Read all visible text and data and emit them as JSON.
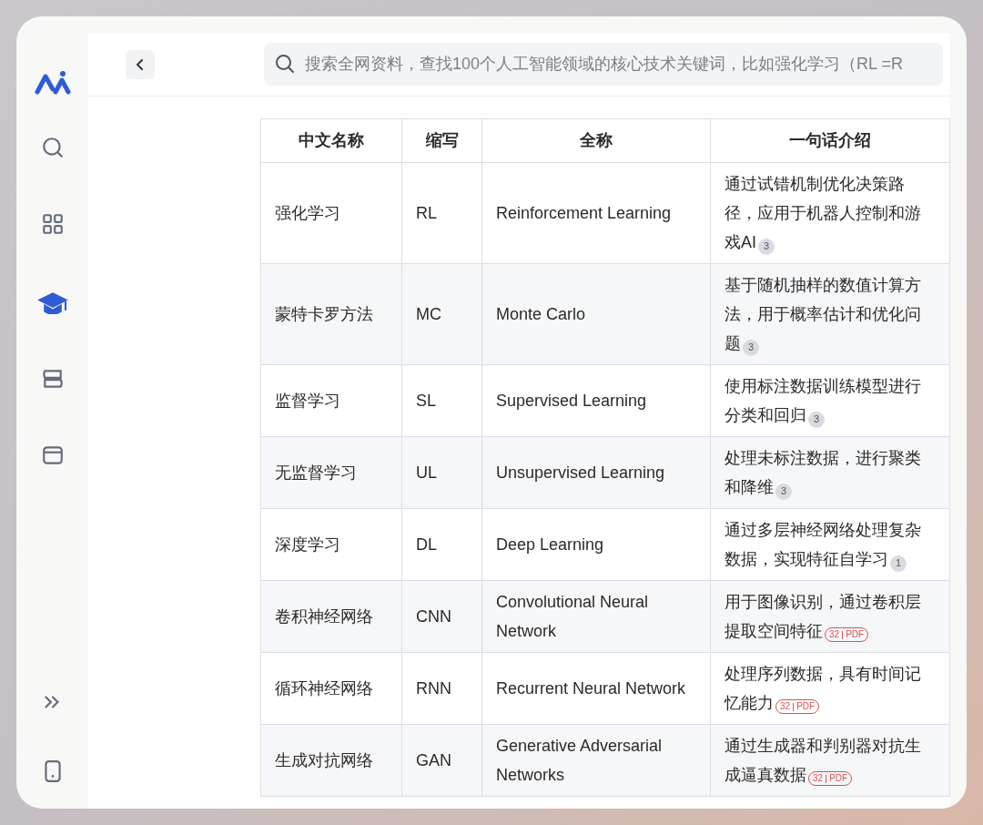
{
  "sidebar": {
    "items": [
      {
        "kind": "search",
        "selected": false
      },
      {
        "kind": "grid",
        "selected": false
      },
      {
        "kind": "graduation",
        "selected": true
      },
      {
        "kind": "books",
        "selected": false
      },
      {
        "kind": "window",
        "selected": false
      }
    ],
    "bottom_items": [
      {
        "kind": "expand"
      },
      {
        "kind": "phone"
      }
    ]
  },
  "search": {
    "placeholder": "搜索全网资料，查找100个人工智能领域的核心技术关键词，比如强化学习（RL =R"
  },
  "table": {
    "columns": [
      "中文名称",
      "缩写",
      "全称",
      "一句话介绍"
    ],
    "rows": [
      {
        "cells": [
          "强化学习",
          "RL",
          "Reinforcement Learning",
          "通过试错机制优化决策路径，应用于机器人控制和游戏AI"
        ],
        "badge": {
          "kind": "count",
          "number": "3"
        }
      },
      {
        "cells": [
          "蒙特卡罗方法",
          "MC",
          "Monte Carlo",
          "基于随机抽样的数值计算方法，用于概率估计和优化问题"
        ],
        "badge": {
          "kind": "count",
          "number": "3"
        }
      },
      {
        "cells": [
          "监督学习",
          "SL",
          "Supervised Learning",
          "使用标注数据训练模型进行分类和回归"
        ],
        "badge": {
          "kind": "count",
          "number": "3"
        }
      },
      {
        "cells": [
          "无监督学习",
          "UL",
          "Unsupervised Learning",
          "处理未标注数据，进行聚类和降维"
        ],
        "badge": {
          "kind": "count",
          "number": "3"
        }
      },
      {
        "cells": [
          "深度学习",
          "DL",
          "Deep Learning",
          "通过多层神经网络处理复杂数据，实现特征自学习"
        ],
        "badge": {
          "kind": "count",
          "number": "1"
        }
      },
      {
        "cells": [
          "卷积神经网络",
          "CNN",
          "Convolutional Neural Network",
          "用于图像识别，通过卷积层提取空间特征"
        ],
        "badge": {
          "kind": "pdf",
          "number": "32",
          "label": "PDF"
        }
      },
      {
        "cells": [
          "循环神经网络",
          "RNN",
          "Recurrent Neural Network",
          "处理序列数据，具有时间记忆能力"
        ],
        "badge": {
          "kind": "pdf",
          "number": "32",
          "label": "PDF"
        }
      },
      {
        "cells": [
          "生成对抗网络",
          "GAN",
          "Generative Adversarial Networks",
          "通过生成器和判别器对抗生成逼真数据"
        ],
        "badge": {
          "kind": "pdf",
          "number": "32",
          "label": "PDF"
        }
      }
    ]
  }
}
